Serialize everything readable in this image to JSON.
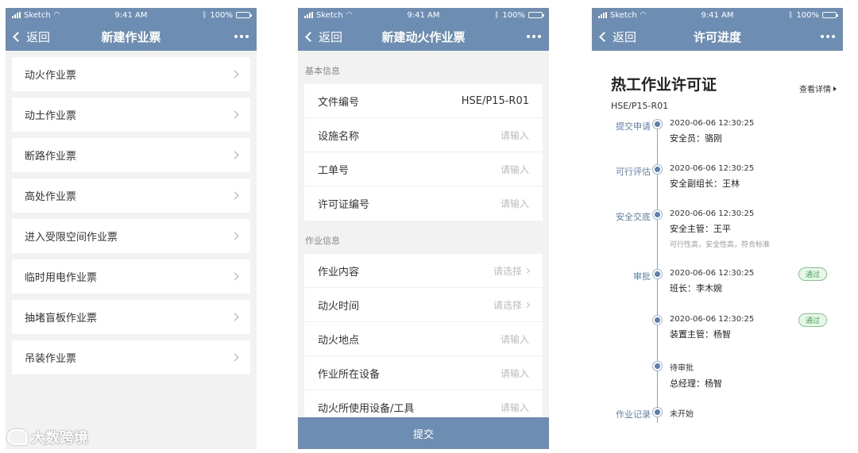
{
  "status_bar": {
    "carrier": "Sketch",
    "time": "9:41 AM",
    "battery": "100%",
    "battery_level": 1.0
  },
  "screen1": {
    "back_label": "返回",
    "title": "新建作业票",
    "items": [
      {
        "label": "动火作业票"
      },
      {
        "label": "动土作业票"
      },
      {
        "label": "断路作业票"
      },
      {
        "label": "高处作业票"
      },
      {
        "label": "进入受限空间作业票"
      },
      {
        "label": "临时用电作业票"
      },
      {
        "label": "抽堵盲板作业票"
      },
      {
        "label": "吊装作业票"
      }
    ],
    "watermark": "大数跨境"
  },
  "screen2": {
    "back_label": "返回",
    "title": "新建动火作业票",
    "sections": [
      {
        "label": "基本信息",
        "fields": [
          {
            "label": "文件编号",
            "value": "HSE/P15-R01",
            "placeholder": "",
            "type": "text"
          },
          {
            "label": "设施名称",
            "value": "",
            "placeholder": "请输入",
            "type": "input"
          },
          {
            "label": "工单号",
            "value": "",
            "placeholder": "请输入",
            "type": "input"
          },
          {
            "label": "许可证编号",
            "value": "",
            "placeholder": "请输入",
            "type": "input"
          }
        ]
      },
      {
        "label": "作业信息",
        "fields": [
          {
            "label": "作业内容",
            "value": "",
            "placeholder": "请选择",
            "type": "select"
          },
          {
            "label": "动火时间",
            "value": "",
            "placeholder": "请选择",
            "type": "select"
          },
          {
            "label": "动火地点",
            "value": "",
            "placeholder": "请输入",
            "type": "input"
          },
          {
            "label": "作业所在设备",
            "value": "",
            "placeholder": "请输入",
            "type": "input"
          },
          {
            "label": "动火所使用设备/工具",
            "value": "",
            "placeholder": "请输入",
            "type": "input"
          }
        ]
      }
    ],
    "submit_label": "提交"
  },
  "screen3": {
    "back_label": "返回",
    "title": "许可进度",
    "permit_title": "热工作业许可证",
    "view_detail": "查看详情",
    "permit_code": "HSE/P15-R01",
    "steps": [
      {
        "stage": "提交申请",
        "time": "2020-06-06 12:30:25",
        "person": "安全员：骆刚",
        "note": "",
        "badge": ""
      },
      {
        "stage": "可行评估",
        "time": "2020-06-06 12:30:25",
        "person": "安全副组长：王林",
        "note": "",
        "badge": ""
      },
      {
        "stage": "安全交底",
        "time": "2020-06-06 12:30:25",
        "person": "安全主管：王平",
        "note": "可行性高，安全性高，符合标准",
        "badge": ""
      },
      {
        "stage": "审批",
        "time": "2020-06-06 12:30:25",
        "person": "班长：李木婉",
        "note": "",
        "badge": "通过"
      },
      {
        "stage": "",
        "time": "2020-06-06 12:30:25",
        "person": "装置主管：杨智",
        "note": "",
        "badge": "通过"
      },
      {
        "stage": "",
        "time": "待审批",
        "person": "总经理：杨智",
        "note": "",
        "badge": ""
      },
      {
        "stage": "作业记录",
        "time": "未开始",
        "person": "",
        "note": "",
        "badge": ""
      }
    ]
  },
  "colors": {
    "header": "#6e8db3",
    "accent": "#5b80b0",
    "badge_green": "#3fa34d"
  },
  "icons": [
    "signal-icon",
    "wifi-icon",
    "bluetooth-icon",
    "battery-icon",
    "back-chevron-icon",
    "more-icon",
    "chevron-right-icon",
    "triangle-right-icon"
  ]
}
